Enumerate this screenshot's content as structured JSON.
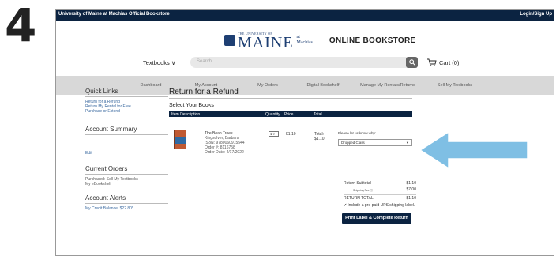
{
  "step_number": "4",
  "topbar": {
    "left": "University of Maine at Machias Official Bookstore",
    "right": "Login/Sign Up"
  },
  "logo": {
    "small_text": "THE UNIVERSITY OF",
    "maine": "MAINE",
    "at": "at",
    "machias": "Machias",
    "online_bookstore": "ONLINE BOOKSTORE"
  },
  "nav": {
    "textbooks": "Textbooks ∨",
    "search_placeholder": "Search",
    "cart": "Cart (0)"
  },
  "menu": [
    "Dashboard",
    "My Account",
    "My Orders",
    "Digital Bookshelf",
    "Manage My Rentals/Returns",
    "Sell My Textbooks"
  ],
  "sidebar": {
    "quick_links_title": "Quick Links",
    "quick_links": [
      "Return for a Refund",
      "Return My Rental for Free",
      "Purchase or Extend"
    ],
    "account_summary_title": "Account Summary",
    "edit": "Edit",
    "current_orders_title": "Current Orders",
    "current_orders": [
      "Purchased: Sell My Textbooks",
      "My eBookshelf"
    ],
    "account_alerts_title": "Account Alerts",
    "credit_balance": "My Credit Balance: $22.80*"
  },
  "main": {
    "title": "Return for a Refund",
    "subtitle": "Select Your Books",
    "headers": {
      "item": "Item Description",
      "qty": "Quantity",
      "price": "Price",
      "total": "Total"
    },
    "book": {
      "title": "The Bean Trees",
      "author": "Kingsolver, Barbara",
      "isbn": "ISBN: 9780060915544",
      "order": "Order #: 8116758",
      "order_date": "Order Date: 4/17/2022",
      "qty": "1 ▾",
      "price": "$1.10",
      "total_label": "Total:",
      "total_value": "$1.10"
    },
    "why_label": "Please let us know why:",
    "why_value": "Dropped Class",
    "summary": {
      "subtotal_label": "Return Subtotal",
      "subtotal_value": "$1.10",
      "shipping_label": "Shipping Fee ⓘ",
      "shipping_value": "$7.00",
      "total_label": "RETURN TOTAL",
      "total_value": "$1.10",
      "prepaid_label": "Include a pre-paid UPS shipping label."
    },
    "print_button": "Print Label & Complete Return"
  },
  "colors": {
    "navy": "#0b2341",
    "arrow": "#7fbfe4",
    "link": "#3b6aa0",
    "menubar": "#d8d8d8"
  }
}
